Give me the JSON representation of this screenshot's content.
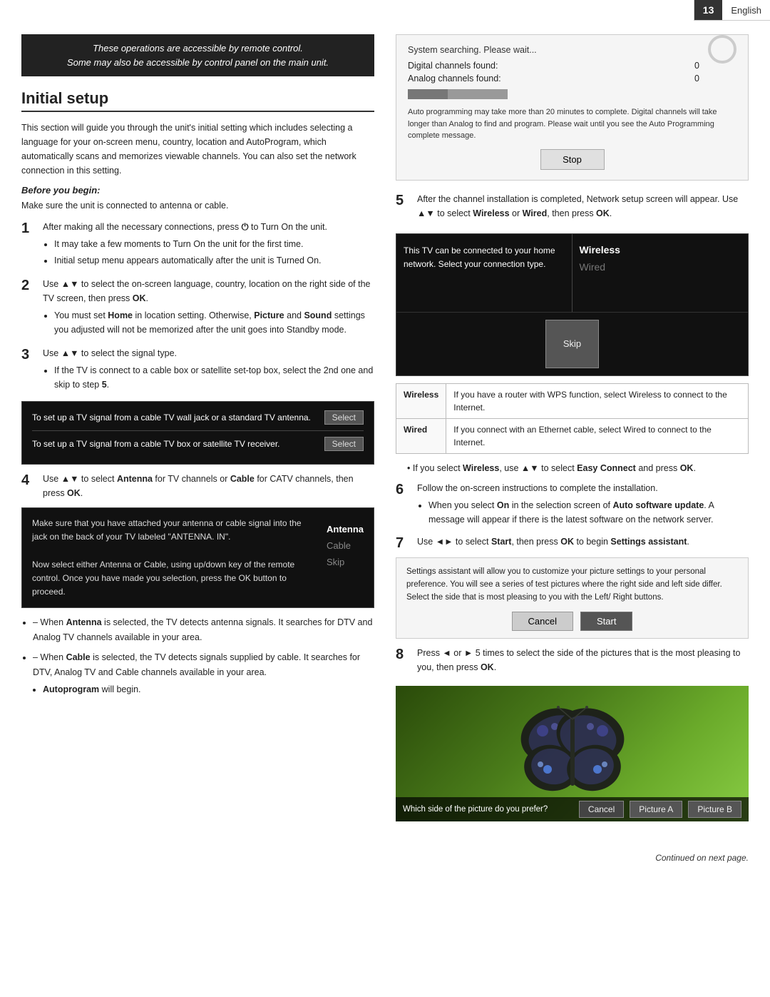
{
  "topbar": {
    "page_number": "13",
    "language": "English"
  },
  "remote_note": {
    "line1": "These operations are accessible by remote control.",
    "line2": "Some may also be accessible by control panel on the main unit."
  },
  "section_title": "Initial setup",
  "intro_text": "This section will guide you through the unit's initial setting which includes selecting a language for your on-screen menu, country, location and AutoProgram, which automatically scans and memorizes viewable channels. You can also set the network connection in this setting.",
  "before_begin": "Before you begin:",
  "before_begin_note": "Make sure the unit is connected to antenna or cable.",
  "steps": [
    {
      "num": "1",
      "text": "After making all the necessary connections, press",
      "text2": "to Turn On the unit.",
      "bullets": [
        "It may take a few moments to Turn On the unit for the first time.",
        "Initial setup menu appears automatically after the unit is Turned On."
      ]
    },
    {
      "num": "2",
      "text": "Use ▲▼ to select the on-screen language, country, location on the right side of the TV screen, then press OK.",
      "bullets": [
        "You must set Home in location setting. Otherwise, Picture and Sound settings you adjusted will not be memorized after the unit goes into Standby mode."
      ]
    },
    {
      "num": "3",
      "text": "Use ▲▼ to select the signal type.",
      "bullets": [
        "If the TV is connect to a cable box or satellite set-top box, select the 2nd one and skip to step 5."
      ]
    }
  ],
  "signal_box": {
    "row1": {
      "label": "To set up a TV signal from a cable TV wall jack or a standard TV antenna.",
      "btn": "Select"
    },
    "row2": {
      "label": "To set up a TV signal from a cable TV box or satellite TV receiver.",
      "btn": "Select"
    }
  },
  "step4": {
    "num": "4",
    "text": "Use ▲▼ to select",
    "bold1": "Antenna",
    "text2": "for TV channels or",
    "bold2": "Cable",
    "text3": "for CATV channels, then press",
    "bold3": "OK",
    "text4": "."
  },
  "antenna_box": {
    "desc": "Make sure that you have attached your antenna or cable signal into the jack on the back of your TV labeled \"ANTENNA. IN\".\n\nNow select either Antenna or Cable, using up/down key of the remote control. Once you have made you selection, press the OK button to proceed.",
    "options": [
      "Antenna",
      "Cable",
      "Skip"
    ]
  },
  "bottom_bullets": [
    "When Antenna is selected, the TV detects antenna signals. It searches for DTV and Analog TV channels available in your area.",
    "When Cable is selected, the TV detects signals supplied by cable. It searches for DTV, Analog TV and Cable channels available in your area."
  ],
  "autoprogram": "Autoprogram will begin.",
  "right_col": {
    "scan_box": {
      "title": "System searching. Please wait...",
      "digital_label": "Digital channels found:",
      "digital_val": "0",
      "analog_label": "Analog channels found:",
      "analog_val": "0",
      "note": "Auto programming may take more than 20 minutes to complete. Digital channels will take longer than Analog to find and program. Please wait until you see the Auto Programming complete message.",
      "stop_btn": "Stop"
    },
    "step5": {
      "num": "5",
      "text": "After the channel installation is completed, Network setup screen will appear. Use ▲▼ to select",
      "bold1": "Wireless",
      "text2": "or",
      "bold2": "Wired",
      "text3": ", then press",
      "bold3": "OK",
      "text4": "."
    },
    "network_box": {
      "left_text": "This TV can be connected to your home network. Select your connection type.",
      "options": [
        "Wireless",
        "Wired"
      ],
      "skip_btn": "Skip"
    },
    "net_table": [
      {
        "label": "Wireless",
        "desc": "If you have a router with WPS function, select Wireless to connect to the Internet."
      },
      {
        "label": "Wired",
        "desc": "If you connect with an Ethernet cable, select Wired to connect to the Internet."
      }
    ],
    "bullet_wireless": "If you select Wireless, use ▲▼ to select Easy Connect and press OK.",
    "step6": {
      "num": "6",
      "text": "Follow the on-screen instructions to complete the installation."
    },
    "step6_bullet": "When you select On in the selection screen of Auto software update. A message will appear if there is the latest software on the network server.",
    "step7": {
      "num": "7",
      "text": "Use ◄► to select",
      "bold1": "Start",
      "text2": ", then press",
      "bold2": "OK",
      "text3": "to begin",
      "bold3": "Settings assistant",
      "text4": "."
    },
    "settings_box": {
      "text": "Settings assistant will allow you to customize your picture settings to your personal preference. You will see a series of test pictures where the right side and left side differ. Select the side that is most pleasing to you with the Left/ Right buttons.",
      "cancel_btn": "Cancel",
      "start_btn": "Start"
    },
    "step8": {
      "num": "8",
      "text": "Press ◄ or ► 5 times to select the side of the pictures that is the most pleasing to you, then press",
      "bold": "OK",
      "text2": "."
    },
    "butterfly_overlay": {
      "label": "Which side of the picture do you prefer?",
      "cancel_btn": "Cancel",
      "picture_a_btn": "Picture A",
      "picture_b_btn": "Picture B"
    }
  },
  "continued": "Continued on next page."
}
